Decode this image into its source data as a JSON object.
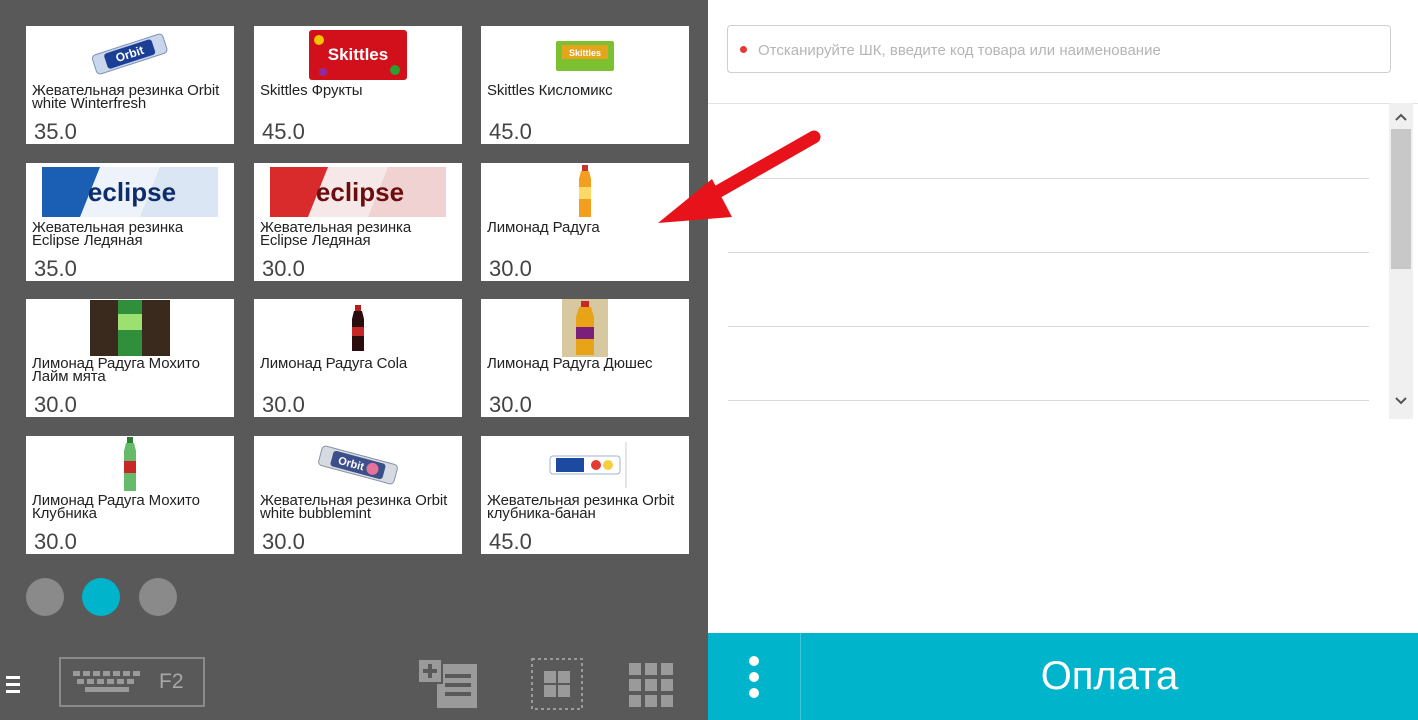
{
  "products": [
    {
      "name": "Жевательная резинка Orbit white Winterfresh",
      "price": "35.0",
      "image": "orbit-white-gum-pack"
    },
    {
      "name": "Skittles Фрукты",
      "price": "45.0",
      "image": "skittles-red-pack"
    },
    {
      "name": "Skittles Кисломикс",
      "price": "45.0",
      "image": "skittles-sour-pack"
    },
    {
      "name": "Жевательная резинка Eclipse Ледяная",
      "price": "35.0",
      "image": "eclipse-blue-pack"
    },
    {
      "name": "Жевательная резинка Eclipse Ледяная",
      "price": "30.0",
      "image": "eclipse-red-pack"
    },
    {
      "name": "Лимонад Радуга",
      "price": "30.0",
      "image": "lemonade-orange-bottle"
    },
    {
      "name": "Лимонад Радуга Мохито Лайм мята",
      "price": "30.0",
      "image": "lemonade-mojito-bottle"
    },
    {
      "name": "Лимонад Радуга Cola",
      "price": "30.0",
      "image": "cola-bottle"
    },
    {
      "name": "Лимонад Радуга Дюшес",
      "price": "30.0",
      "image": "duchess-bottle"
    },
    {
      "name": "Лимонад Радуга Мохито Клубника",
      "price": "30.0",
      "image": "lemonade-green-bottle"
    },
    {
      "name": "Жевательная резинка Orbit white bubblemint",
      "price": "30.0",
      "image": "orbit-bubblemint-pack"
    },
    {
      "name": "Жевательная резинка Orbit клубника-банан",
      "price": "45.0",
      "image": "orbit-strawberry-banana-pack"
    }
  ],
  "pagination": {
    "pages": 3,
    "active_page": 2
  },
  "toolbar": {
    "keyboard_shortcut": "F2"
  },
  "search": {
    "placeholder": "Отсканируйте ШК, введите код товара или наименование",
    "value": ""
  },
  "pay_button": {
    "label": "Оплата"
  },
  "colors": {
    "accent": "#00b4cc",
    "panel": "#595959",
    "arrow": "#e8131a"
  }
}
